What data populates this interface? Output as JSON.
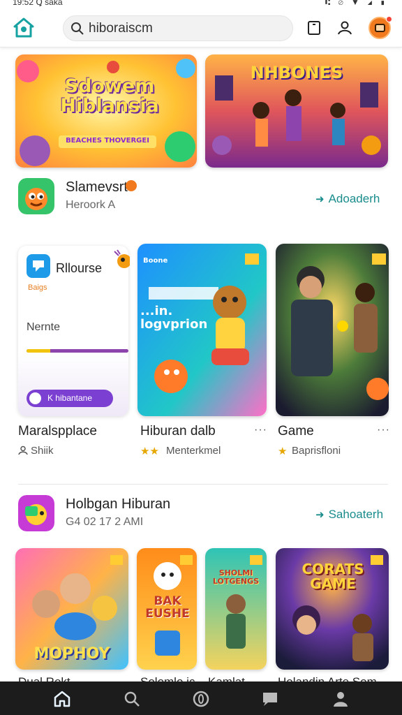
{
  "status_bar": {
    "time": "19:52 Ꝗ saka",
    "system": "⑆ ⊘ ▼ ◢ ▮"
  },
  "header": {
    "search_value": "hiboraiscm",
    "search_placeholder": "hiboraiscm"
  },
  "banners": [
    {
      "headline": "Sdowem Hiblansia",
      "caption": "BEACHES THOVERGEI"
    },
    {
      "headline": "NHBONES"
    }
  ],
  "section1": {
    "title": "Slamevsrt",
    "subtitle": "Heroork A",
    "see_all": "Adoaderh"
  },
  "promo": {
    "title": "Rllourse",
    "tag": "Baigs",
    "section_label": "Nernte",
    "button_label": "K hibantane",
    "progress_fraction": 0.23
  },
  "games_row1": [
    {
      "title": "Maralspplace",
      "subtitle": "Shiik",
      "art_text": "...in. logvprion",
      "art_top": "Boone"
    },
    {
      "title": "Hiburan dalb",
      "subtitle": "Menterkmel",
      "rating": "★★"
    },
    {
      "title": "Game",
      "subtitle": "Baprisfloni",
      "rating": "★"
    }
  ],
  "section2": {
    "title": "Holbgan Hiburan",
    "subtitle": "G4 02 17 2 AMI",
    "see_all": "Sahoaterh"
  },
  "games_row2": [
    {
      "art_text": "MOPHOY",
      "partial_title": "Dual Rekt"
    },
    {
      "art_text": "BAK EUSHE",
      "partial_title": "Solomlo ic"
    },
    {
      "art_text": "SHOLMI LOTGENGS",
      "partial_title": "Kamlat"
    },
    {
      "art_text": "CORATS GAME",
      "partial_title": "Holandin Arte Som"
    }
  ],
  "colors": {
    "accent": "#1a8c8c",
    "primary_button": "#7b3fd1",
    "badge": "#f07a1d",
    "nav_bg": "#1c1c1c"
  },
  "icons": {
    "logo": "home-logo-icon",
    "search": "search-icon",
    "tablet": "tablet-icon",
    "profile": "user-icon",
    "nav": [
      "home-icon",
      "search-icon",
      "circle-icon",
      "chat-icon",
      "person-icon"
    ]
  }
}
